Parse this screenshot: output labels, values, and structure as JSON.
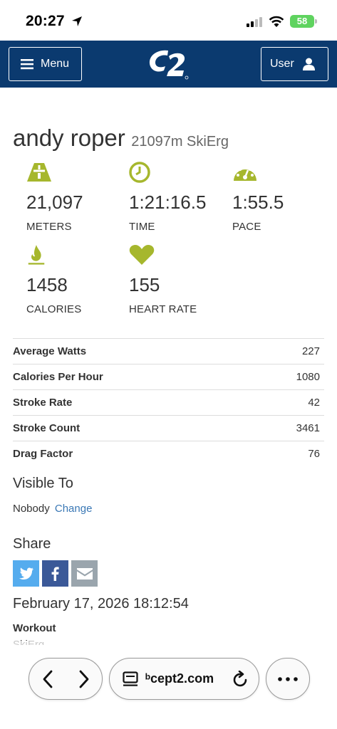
{
  "status_bar": {
    "time": "20:27",
    "battery": "58"
  },
  "header": {
    "menu_label": "Menu",
    "user_label": "User",
    "logo_text": "C2"
  },
  "workout": {
    "athlete": "andy roper",
    "description": "21097m SkiErg",
    "stats": [
      {
        "icon": "road-icon",
        "value": "21,097",
        "label": "METERS"
      },
      {
        "icon": "clock-icon",
        "value": "1:21:16.5",
        "label": "TIME"
      },
      {
        "icon": "speedometer-icon",
        "value": "1:55.5",
        "label": "PACE"
      },
      {
        "icon": "flame-icon",
        "value": "1458",
        "label": "CALORIES"
      },
      {
        "icon": "heart-icon",
        "value": "155",
        "label": "HEART RATE"
      }
    ],
    "metrics": [
      {
        "label": "Average Watts",
        "value": "227"
      },
      {
        "label": "Calories Per Hour",
        "value": "1080"
      },
      {
        "label": "Stroke Rate",
        "value": "42"
      },
      {
        "label": "Stroke Count",
        "value": "3461"
      },
      {
        "label": "Drag Factor",
        "value": "76"
      }
    ],
    "visible_to": {
      "title": "Visible To",
      "value": "Nobody",
      "change_label": "Change"
    },
    "share": {
      "title": "Share"
    },
    "date": "February 17, 2026 18:12:54",
    "workout_label": "Workout",
    "workout_type": "SkiErg"
  },
  "browser": {
    "url": "ᵇcept2.com"
  },
  "colors": {
    "header_bg": "#0b3a6f",
    "accent": "#a6b72d",
    "link": "#3a78b5"
  }
}
